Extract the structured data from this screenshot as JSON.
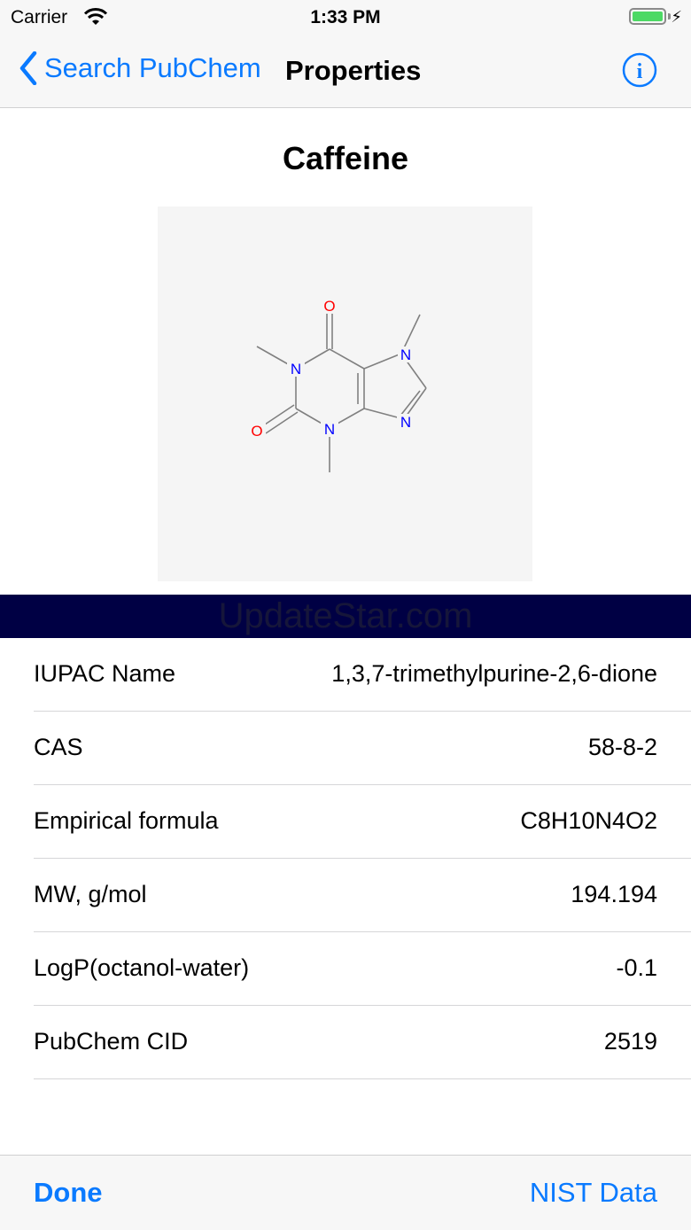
{
  "status_bar": {
    "carrier": "Carrier",
    "time": "1:33 PM",
    "battery_level": 1.0,
    "charging_icon": "bolt-icon"
  },
  "nav": {
    "back_label": "Search PubChem",
    "title": "Properties",
    "info_icon": "info-icon"
  },
  "compound": {
    "name": "Caffeine",
    "structure_labels": {
      "o1": "O",
      "o2": "O",
      "n1": "N",
      "n3": "N",
      "n7": "N",
      "n9": "N"
    }
  },
  "banner": {
    "text": "UpdateStar.com"
  },
  "properties": [
    {
      "label": "IUPAC Name",
      "value": "1,3,7-trimethylpurine-2,6-dione"
    },
    {
      "label": "CAS",
      "value": "58-8-2"
    },
    {
      "label": "Empirical formula",
      "value": "C8H10N4O2"
    },
    {
      "label": "MW, g/mol",
      "value": "194.194"
    },
    {
      "label": "LogP(octanol-water)",
      "value": "-0.1"
    },
    {
      "label": "PubChem CID",
      "value": "2519"
    }
  ],
  "toolbar": {
    "done_label": "Done",
    "nist_label": "NIST Data"
  },
  "colors": {
    "accent": "#0a7aff",
    "banner": "#000044",
    "battery": "#4cd964",
    "atom_n": "#0000ff",
    "atom_o": "#ff0000"
  }
}
